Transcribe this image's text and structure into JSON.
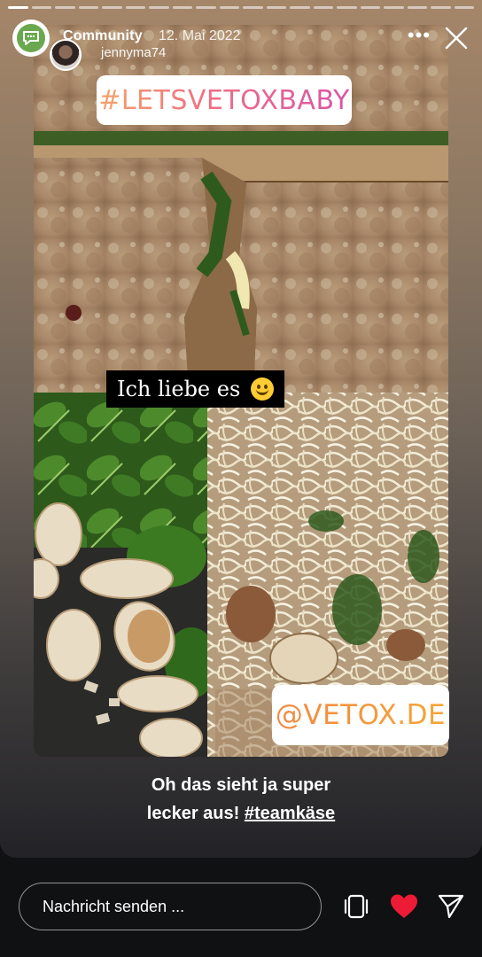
{
  "story": {
    "author": "Community",
    "date": "12. Mai 2022",
    "sub_user": "jennyma74",
    "more_label": "•••",
    "progress_segments": 20,
    "active_segment": 1
  },
  "stickers": {
    "hashtag": "#LETSVETOXBABY",
    "caption": "Ich liebe es",
    "mention": "@VETOX.DE"
  },
  "comment": {
    "line1": "Oh das sieht ja super",
    "line2_prefix": "lecker aus! ",
    "line2_tag": "#teamkäse"
  },
  "footer": {
    "message_placeholder": "Nachricht senden ...",
    "icons": [
      "cards-icon",
      "heart-icon",
      "send-icon"
    ],
    "heart_color": "#ed1b35"
  },
  "colors": {
    "story_ring": "#6aa84f"
  }
}
